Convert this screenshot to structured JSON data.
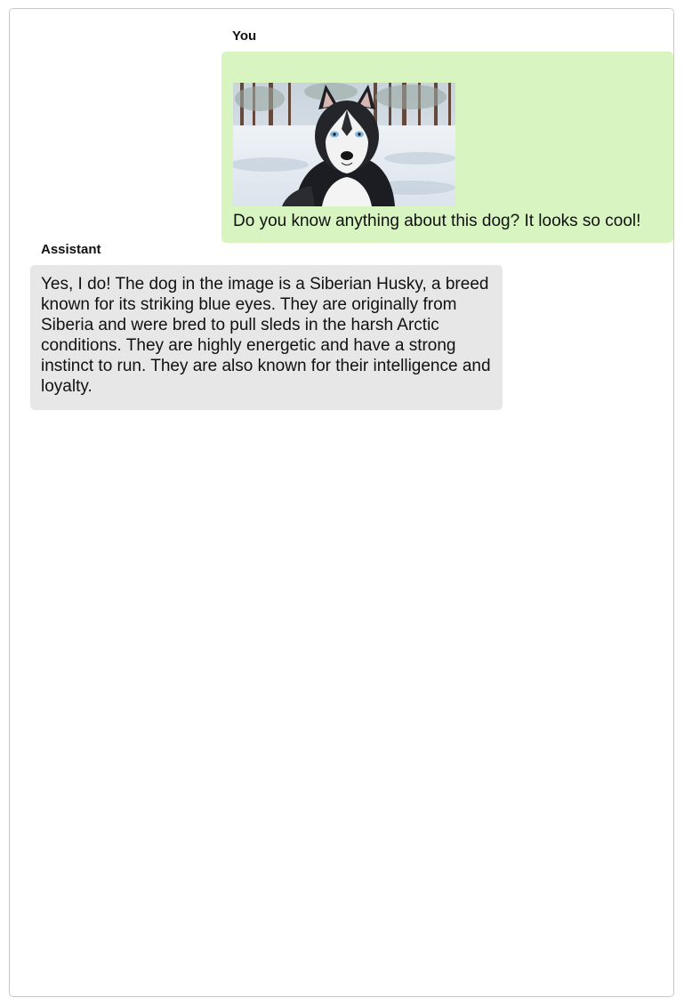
{
  "conversation": {
    "messages": [
      {
        "speaker": "You",
        "image": {
          "subject": "siberian-husky-photo",
          "background_color": "#e9eef3"
        },
        "text": "Do you know anything about this dog? It looks so cool!",
        "bubble_color": "#d8f5c1"
      },
      {
        "speaker": "Assistant",
        "text": "Yes, I do! The dog in the image is a Siberian Husky, a breed known for its striking blue eyes. They are originally from Siberia and were bred to pull sleds in the harsh Arctic conditions. They are highly energetic and have a strong instinct to run. They are also known for their intelligence and loyalty.",
        "bubble_color": "#e7e7e7"
      }
    ]
  }
}
